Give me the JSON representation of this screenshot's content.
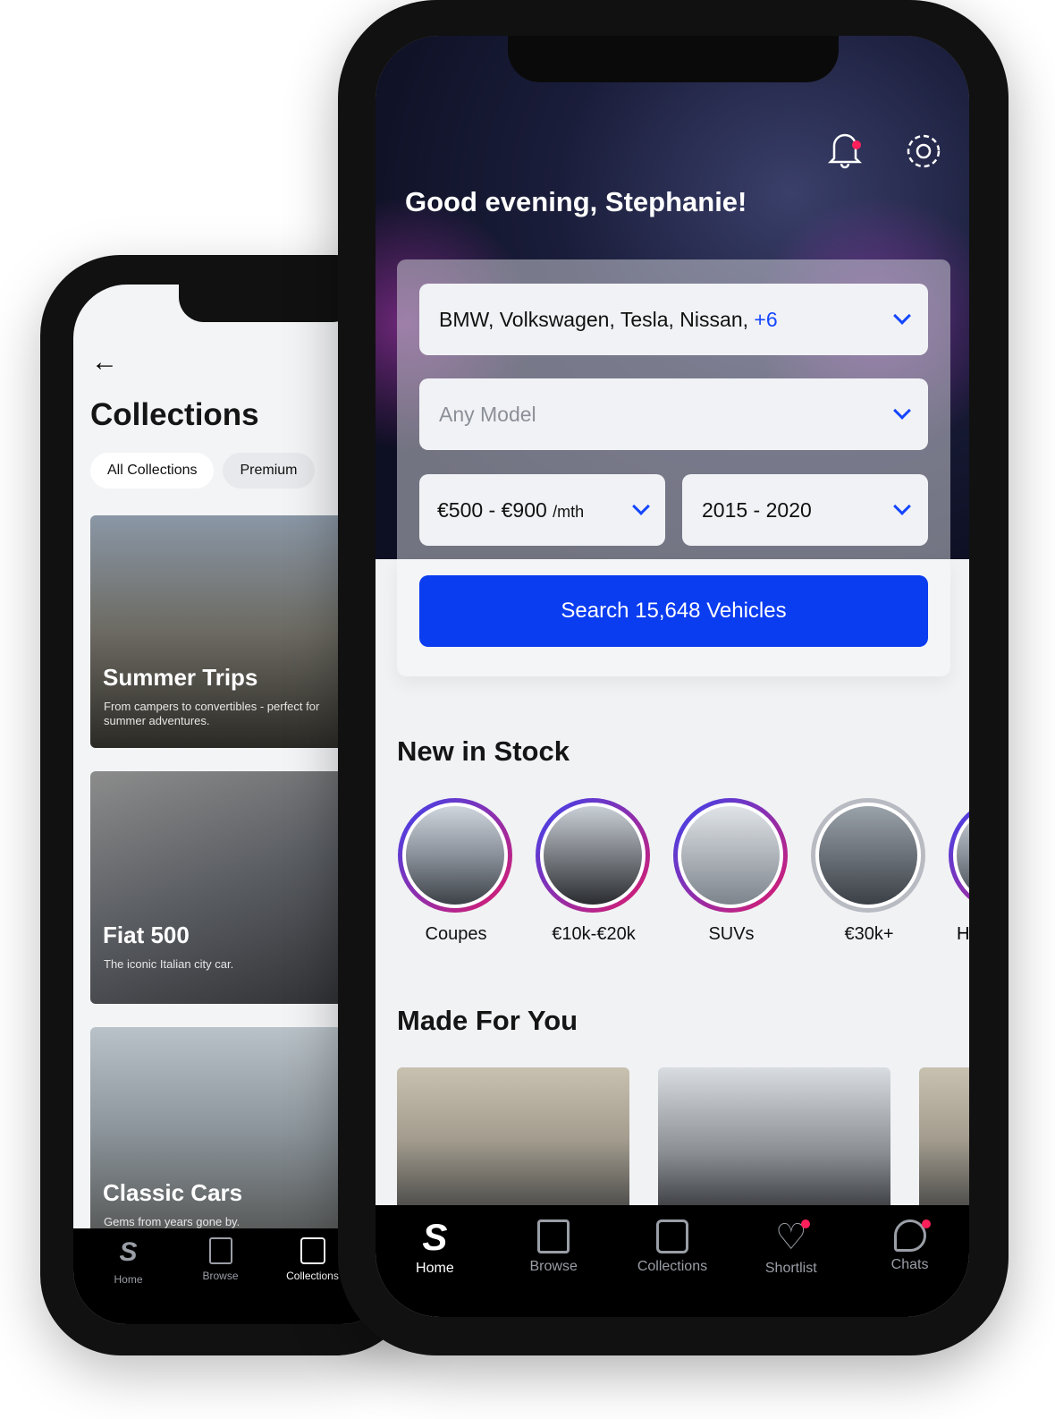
{
  "back_phone": {
    "title": "Collections",
    "filters": [
      "All Collections",
      "Premium"
    ],
    "cards": [
      {
        "title": "Summer Trips",
        "desc": "From campers to convertibles - perfect for summer adventures."
      },
      {
        "title": "Fiat 500",
        "desc": "The iconic Italian city car."
      },
      {
        "title": "Classic Cars",
        "desc": "Gems from years gone by."
      }
    ],
    "nav": [
      {
        "label": "Home",
        "icon": "s-logo-icon"
      },
      {
        "label": "Browse",
        "icon": "cards-icon"
      },
      {
        "label": "Collections",
        "icon": "stack-icon",
        "active": true
      }
    ]
  },
  "front_phone": {
    "greeting": "Good evening, Stephanie!",
    "makes": "BMW, Volkswagen, Tesla, Nissan, ",
    "makes_more": "+6",
    "model_placeholder": "Any Model",
    "price": "€500 - €900",
    "price_unit": "/mth",
    "year": "2015 - 2020",
    "search_button": "Search 15,648 Vehicles",
    "new_in_stock": "New in Stock",
    "categories": [
      "Coupes",
      "€10k-€20k",
      "SUVs",
      "€30k+",
      "H"
    ],
    "made_for_you": "Made For You",
    "nav": [
      {
        "label": "Home",
        "icon": "s-logo-icon",
        "active": true
      },
      {
        "label": "Browse",
        "icon": "cards-icon"
      },
      {
        "label": "Collections",
        "icon": "stack-icon"
      },
      {
        "label": "Shortlist",
        "icon": "heart-icon",
        "badge": true
      },
      {
        "label": "Chats",
        "icon": "chat-icon",
        "badge": true
      }
    ]
  },
  "colors": {
    "accent": "#0a3cf0",
    "badge": "#ff1f5a"
  }
}
